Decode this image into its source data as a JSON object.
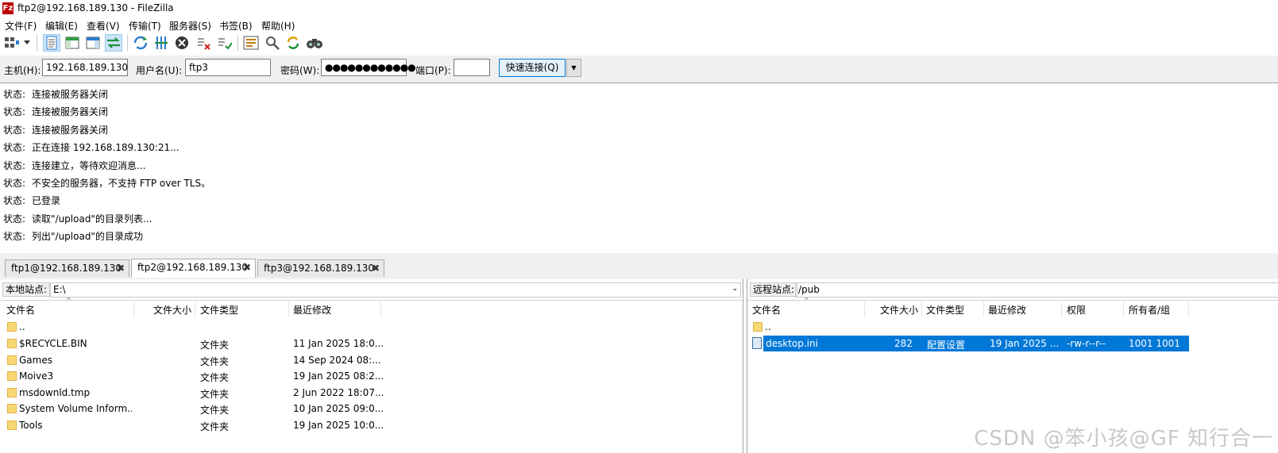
{
  "window": {
    "title": "ftp2@192.168.189.130 - FileZilla",
    "app_icon_glyph": "Fz"
  },
  "menu": [
    {
      "label": "文件(F)"
    },
    {
      "label": "编辑(E)"
    },
    {
      "label": "查看(V)"
    },
    {
      "label": "传输(T)"
    },
    {
      "label": "服务器(S)"
    },
    {
      "label": "书签(B)"
    },
    {
      "label": "帮助(H)"
    }
  ],
  "toolbar": [
    {
      "icon": "site-manager-icon"
    },
    {
      "icon": "dropdown-arrow-icon"
    },
    {
      "icon": "toggle-message-log-icon",
      "active": true
    },
    {
      "icon": "toggle-local-tree-icon"
    },
    {
      "icon": "toggle-remote-tree-icon"
    },
    {
      "icon": "toggle-transfer-queue-icon",
      "active": true
    },
    {
      "icon": "refresh-icon"
    },
    {
      "icon": "process-queue-icon"
    },
    {
      "icon": "cancel-icon"
    },
    {
      "icon": "disconnect-icon"
    },
    {
      "icon": "reconnect-icon"
    },
    {
      "icon": "directory-filter-icon"
    },
    {
      "icon": "directory-compare-icon"
    },
    {
      "icon": "sync-browse-icon"
    },
    {
      "icon": "search-icon"
    }
  ],
  "quickconnect": {
    "host_label": "主机(H):",
    "host_value": "192.168.189.130",
    "user_label": "用户名(U):",
    "user_value": "ftp3",
    "pass_label": "密码(W):",
    "pass_value": "●●●●●●●●●●●●",
    "port_label": "端口(P):",
    "port_value": "",
    "button_label": "快速连接(Q)",
    "dropdown_glyph": "▼"
  },
  "log": [
    {
      "kind": "状态:",
      "text": "连接被服务器关闭"
    },
    {
      "kind": "状态:",
      "text": "连接被服务器关闭"
    },
    {
      "kind": "状态:",
      "text": "连接被服务器关闭"
    },
    {
      "kind": "状态:",
      "text": "正在连接 192.168.189.130:21..."
    },
    {
      "kind": "状态:",
      "text": "连接建立，等待欢迎消息..."
    },
    {
      "kind": "状态:",
      "text": "不安全的服务器，不支持 FTP over TLS。"
    },
    {
      "kind": "状态:",
      "text": "已登录"
    },
    {
      "kind": "状态:",
      "text": "读取\"/upload\"的目录列表..."
    },
    {
      "kind": "状态:",
      "text": "列出\"/upload\"的目录成功"
    }
  ],
  "tabs": [
    {
      "label": "ftp1@192.168.189.130",
      "close": "✖"
    },
    {
      "label": "ftp2@192.168.189.130",
      "close": "✖",
      "active": true
    },
    {
      "label": "ftp3@192.168.189.130",
      "close": "✖"
    }
  ],
  "local": {
    "site_label": "本地站点:",
    "path": "E:\\",
    "headers": {
      "name": "文件名",
      "size": "文件大小",
      "type": "文件类型",
      "modified": "最近修改"
    },
    "rows": [
      {
        "name": "..",
        "size": "",
        "type": "",
        "modified": "",
        "icon": "folder-icon"
      },
      {
        "name": "$RECYCLE.BIN",
        "size": "",
        "type": "文件夹",
        "modified": "11 Jan 2025 18:0...",
        "icon": "folder-icon"
      },
      {
        "name": "Games",
        "size": "",
        "type": "文件夹",
        "modified": "14 Sep 2024 08:...",
        "icon": "folder-icon"
      },
      {
        "name": "Moive3",
        "size": "",
        "type": "文件夹",
        "modified": "19 Jan 2025 08:2...",
        "icon": "folder-icon"
      },
      {
        "name": "msdownld.tmp",
        "size": "",
        "type": "文件夹",
        "modified": "2 Jun 2022 18:07...",
        "icon": "folder-icon"
      },
      {
        "name": "System Volume Inform...",
        "size": "",
        "type": "文件夹",
        "modified": "10 Jan 2025 09:0...",
        "icon": "folder-icon"
      },
      {
        "name": "Tools",
        "size": "",
        "type": "文件夹",
        "modified": "19 Jan 2025 10:0...",
        "icon": "folder-icon"
      }
    ]
  },
  "remote": {
    "site_label": "远程站点:",
    "path": "/pub",
    "headers": {
      "name": "文件名",
      "size": "文件大小",
      "type": "文件类型",
      "modified": "最近修改",
      "perms": "权限",
      "owner": "所有者/组"
    },
    "rows": [
      {
        "name": "..",
        "size": "",
        "type": "",
        "modified": "",
        "perms": "",
        "owner": "",
        "icon": "folder-icon"
      },
      {
        "name": "desktop.ini",
        "size": "282",
        "type": "配置设置",
        "modified": "19 Jan 2025 ...",
        "perms": "-rw-r--r--",
        "owner": "1001 1001",
        "icon": "file-icon",
        "selected": true
      }
    ]
  },
  "watermark": "CSDN @笨小孩@GF 知行合一"
}
